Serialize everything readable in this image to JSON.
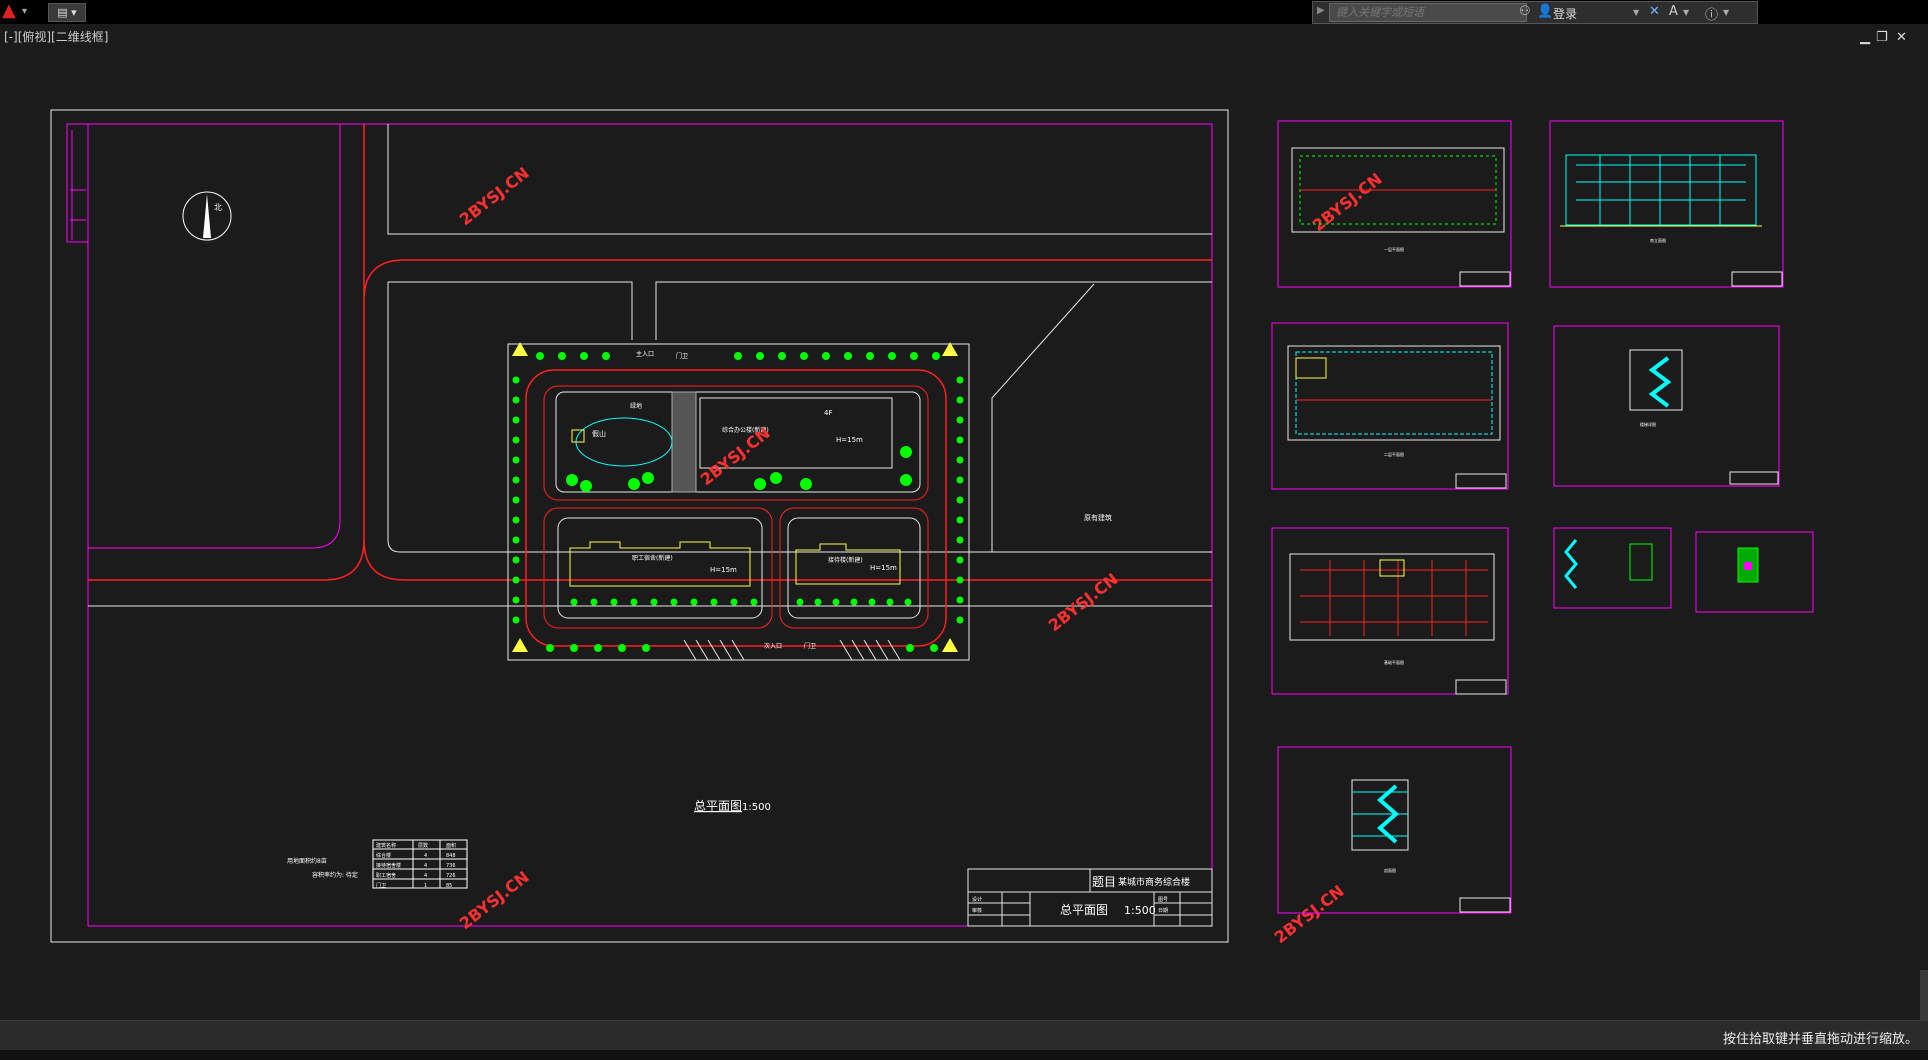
{
  "titlebar": {
    "quick_access_icon": "document-icon",
    "search_placeholder": "键入关键字或短语",
    "login_label": "登录",
    "help_icon": "help-icon"
  },
  "viewport": {
    "label": "[-][俯视][二维线框]"
  },
  "status": {
    "message": "按住拾取键并垂直拖动进行缩放。"
  },
  "drawing": {
    "watermark": "2BYSJ.CN",
    "north_label": "北",
    "building_main": "4F",
    "building_height": "H=15m",
    "building_a": "综合办公楼(新建)",
    "building_b": "接待楼(新建)",
    "building_c": "职工宿舍(新建)",
    "garden_label": "假山",
    "lawn_label": "绿地",
    "gate_main": "主入口",
    "gate_side": "次入口",
    "gate_label": "门卫",
    "neighbor_label": "原有建筑",
    "site_title": "总平面图",
    "site_scale": "1:500",
    "notes": [
      "用地面积约8亩",
      "容积率约为: 待定"
    ],
    "table_header": [
      "建筑名称",
      "层数",
      "面积"
    ],
    "table_rows": [
      [
        "综合楼",
        "4",
        "848"
      ],
      [
        "接待宿舍楼",
        "4",
        "736"
      ],
      [
        "职工宿舍",
        "4",
        "726"
      ],
      [
        "门卫",
        "1",
        "85"
      ]
    ],
    "titleblock": {
      "topic_label": "题目",
      "topic_value": "某城市商务综合楼",
      "drawing_name": "总平面图",
      "scale": "1:500",
      "labels": [
        "设计",
        "审核",
        "图号",
        "日期"
      ]
    },
    "sheet_titles": [
      "一层平面图",
      "南立面图",
      "二层平面图",
      "楼梯详图",
      "基础平面图",
      "剖面图"
    ]
  },
  "colors": {
    "background": "#1b1b1b",
    "frame": "#ffffff",
    "border": "#ff00ff",
    "road": "#ff2020",
    "tree": "#00ff00",
    "watermark": "#ff2a2a",
    "building": "#ffff44",
    "pond": "#00ffff"
  }
}
